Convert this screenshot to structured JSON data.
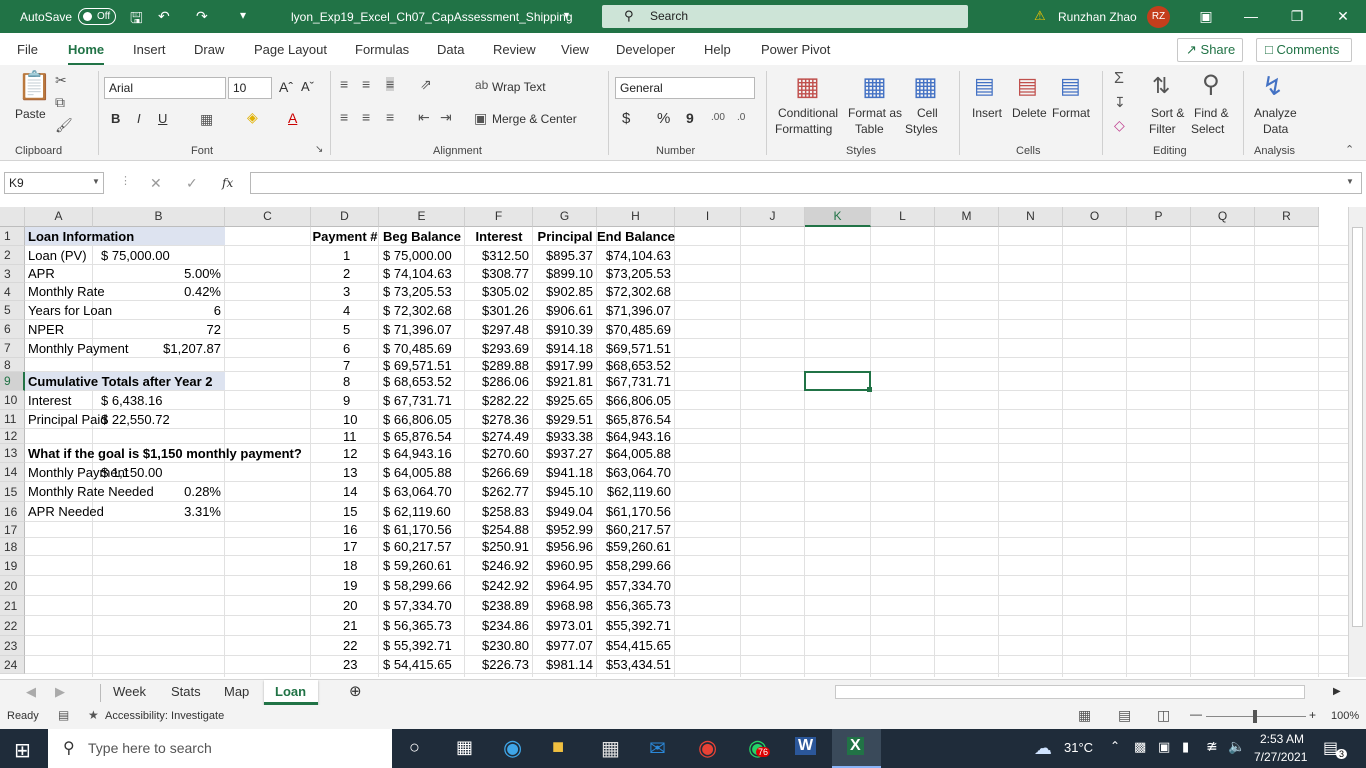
{
  "title_bar": {
    "autosave_label": "AutoSave",
    "autosave_state": "Off",
    "file_name": "lyon_Exp19_Excel_Ch07_CapAssessment_Shipping",
    "search_placeholder": "Search",
    "user_name": "Runzhan Zhao",
    "user_initials": "RZ",
    "accent_color": "#217346"
  },
  "menu": {
    "tabs": [
      "File",
      "Home",
      "Insert",
      "Draw",
      "Page Layout",
      "Formulas",
      "Data",
      "Review",
      "View",
      "Developer",
      "Help",
      "Power Pivot"
    ],
    "active_tab": "Home",
    "share_label": "Share",
    "comments_label": "Comments"
  },
  "ribbon": {
    "clipboard": {
      "paste": "Paste",
      "group": "Clipboard"
    },
    "font": {
      "name": "Arial",
      "size": "10",
      "group": "Font",
      "bold": "B",
      "italic": "I",
      "underline": "U"
    },
    "alignment": {
      "wrap": "Wrap Text",
      "merge": "Merge & Center",
      "group": "Alignment"
    },
    "number": {
      "format": "General",
      "group": "Number",
      "currency": "$",
      "percent": "%",
      "comma": "9"
    },
    "styles": {
      "cond1": "Conditional",
      "cond2": "Formatting",
      "fmt1": "Format as",
      "fmt2": "Table",
      "cell1": "Cell",
      "cell2": "Styles",
      "group": "Styles"
    },
    "cells": {
      "insert": "Insert",
      "delete": "Delete",
      "format": "Format",
      "group": "Cells"
    },
    "editing": {
      "sort1": "Sort &",
      "sort2": "Filter",
      "find1": "Find &",
      "find2": "Select",
      "group": "Editing"
    },
    "analysis": {
      "analyze1": "Analyze",
      "analyze2": "Data",
      "group": "Analysis"
    }
  },
  "formula_bar": {
    "name_box": "K9",
    "fx": "fx",
    "formula": ""
  },
  "columns": [
    "A",
    "B",
    "C",
    "D",
    "E",
    "F",
    "G",
    "H",
    "I",
    "J",
    "K",
    "L",
    "M",
    "N",
    "O",
    "P",
    "Q",
    "R"
  ],
  "rows": [
    "1",
    "2",
    "3",
    "4",
    "5",
    "6",
    "7",
    "8",
    "9",
    "10",
    "11",
    "12",
    "13",
    "14",
    "15",
    "16",
    "17",
    "18",
    "19",
    "20",
    "21",
    "22",
    "23",
    "24"
  ],
  "cells_left": [
    {
      "a": "Loan Information",
      "b": "",
      "bold": true
    },
    {
      "a": "Loan (PV)",
      "b": "$ 75,000.00"
    },
    {
      "a": "APR",
      "b": "5.00%"
    },
    {
      "a": "Monthly Rate",
      "b": "0.42%"
    },
    {
      "a": "Years for Loan",
      "b": "6"
    },
    {
      "a": "NPER",
      "b": "72"
    },
    {
      "a": "Monthly Payment",
      "b": "$1,207.87"
    },
    {
      "a": "",
      "b": ""
    },
    {
      "a": "Cumulative Totals after Year 2",
      "b": "",
      "bold": true
    },
    {
      "a": "Interest",
      "b": "$ 6,438.16"
    },
    {
      "a": "Principal Paid",
      "b": "$ 22,550.72"
    },
    {
      "a": "",
      "b": ""
    },
    {
      "a": "What if the goal is $1,150 monthly payment?",
      "b": "",
      "bold": true
    },
    {
      "a": "Monthly Payment",
      "b": "$ 1,150.00"
    },
    {
      "a": "Monthly Rate Needed",
      "b": "0.28%"
    },
    {
      "a": "APR Needed",
      "b": "3.31%"
    }
  ],
  "amort_headers": [
    "Payment #",
    "Beg Balance",
    "Interest",
    "Principal",
    "End Balance"
  ],
  "amort_rows": [
    [
      "1",
      "$ 75,000.00",
      "$312.50",
      "$895.37",
      "$74,104.63"
    ],
    [
      "2",
      "$ 74,104.63",
      "$308.77",
      "$899.10",
      "$73,205.53"
    ],
    [
      "3",
      "$ 73,205.53",
      "$305.02",
      "$902.85",
      "$72,302.68"
    ],
    [
      "4",
      "$ 72,302.68",
      "$301.26",
      "$906.61",
      "$71,396.07"
    ],
    [
      "5",
      "$ 71,396.07",
      "$297.48",
      "$910.39",
      "$70,485.69"
    ],
    [
      "6",
      "$ 70,485.69",
      "$293.69",
      "$914.18",
      "$69,571.51"
    ],
    [
      "7",
      "$ 69,571.51",
      "$289.88",
      "$917.99",
      "$68,653.52"
    ],
    [
      "8",
      "$ 68,653.52",
      "$286.06",
      "$921.81",
      "$67,731.71"
    ],
    [
      "9",
      "$ 67,731.71",
      "$282.22",
      "$925.65",
      "$66,806.05"
    ],
    [
      "10",
      "$ 66,806.05",
      "$278.36",
      "$929.51",
      "$65,876.54"
    ],
    [
      "11",
      "$ 65,876.54",
      "$274.49",
      "$933.38",
      "$64,943.16"
    ],
    [
      "12",
      "$ 64,943.16",
      "$270.60",
      "$937.27",
      "$64,005.88"
    ],
    [
      "13",
      "$ 64,005.88",
      "$266.69",
      "$941.18",
      "$63,064.70"
    ],
    [
      "14",
      "$ 63,064.70",
      "$262.77",
      "$945.10",
      "$62,119.60"
    ],
    [
      "15",
      "$ 62,119.60",
      "$258.83",
      "$949.04",
      "$61,170.56"
    ],
    [
      "16",
      "$ 61,170.56",
      "$254.88",
      "$952.99",
      "$60,217.57"
    ],
    [
      "17",
      "$ 60,217.57",
      "$250.91",
      "$956.96",
      "$59,260.61"
    ],
    [
      "18",
      "$ 59,260.61",
      "$246.92",
      "$960.95",
      "$58,299.66"
    ],
    [
      "19",
      "$ 58,299.66",
      "$242.92",
      "$964.95",
      "$57,334.70"
    ],
    [
      "20",
      "$ 57,334.70",
      "$238.89",
      "$968.98",
      "$56,365.73"
    ],
    [
      "21",
      "$ 56,365.73",
      "$234.86",
      "$973.01",
      "$55,392.71"
    ],
    [
      "22",
      "$ 55,392.71",
      "$230.80",
      "$977.07",
      "$54,415.65"
    ],
    [
      "23",
      "$ 54,415.65",
      "$226.73",
      "$981.14",
      "$53,434.51"
    ]
  ],
  "sheets": [
    "Week",
    "Stats",
    "Map",
    "Loan"
  ],
  "active_sheet": "Loan",
  "status": {
    "ready": "Ready",
    "accessibility": "Accessibility: Investigate",
    "zoom": "100%"
  },
  "taskbar": {
    "search_placeholder": "Type here to search",
    "temperature": "31°C",
    "time": "2:53 AM",
    "date": "7/27/2021",
    "chrome_badge": "76",
    "notifications": "3"
  }
}
